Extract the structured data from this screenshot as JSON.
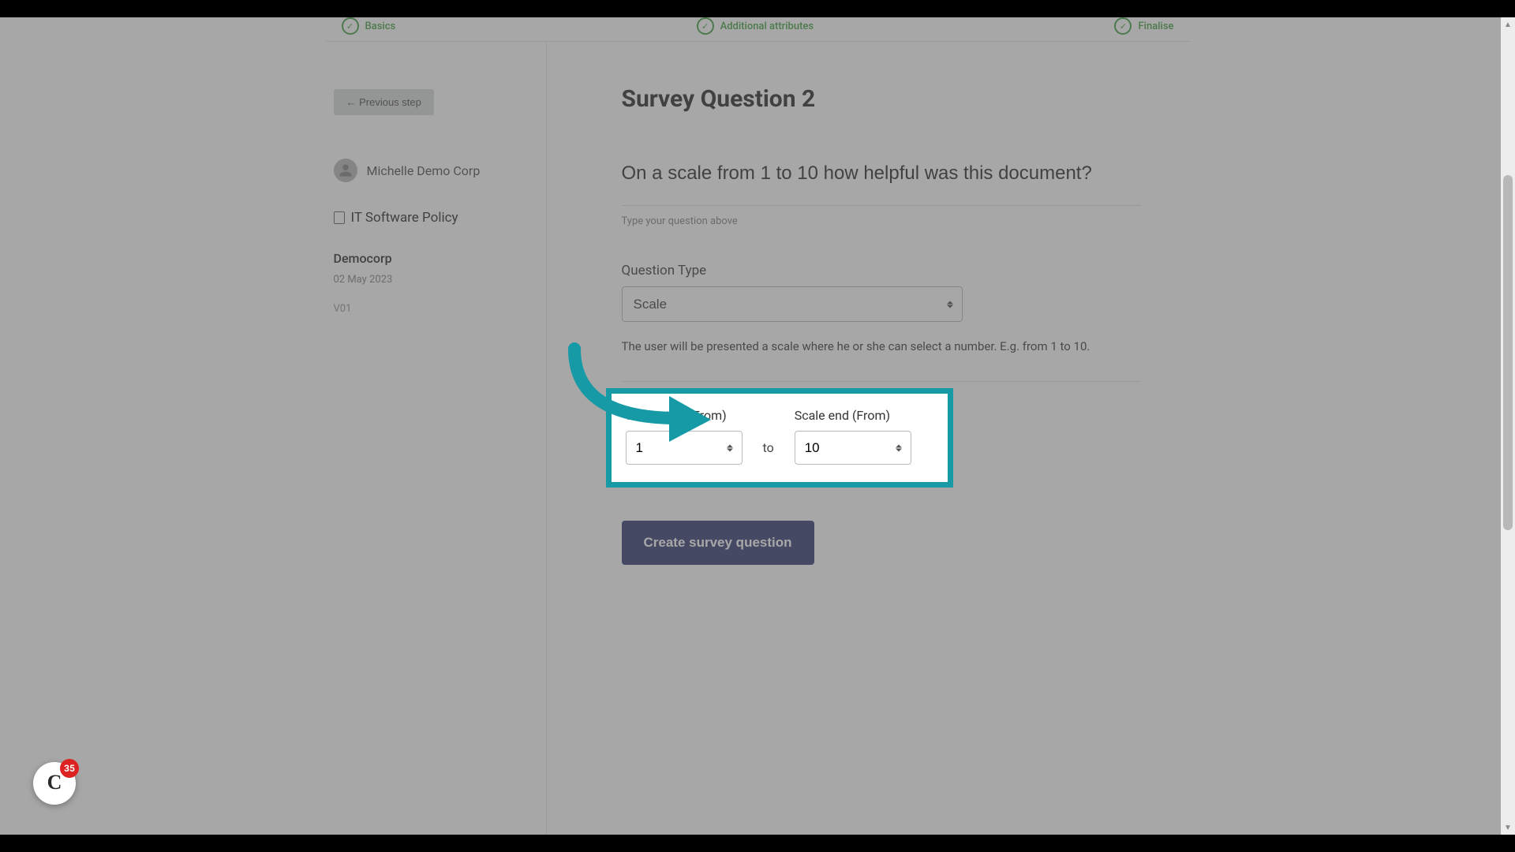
{
  "steps": {
    "one": "Basics",
    "two": "Additional attributes",
    "three": "Finalise"
  },
  "sidebar": {
    "prev_label": "← Previous step",
    "user_name": "Michelle Demo Corp",
    "doc_name": "IT Software Policy",
    "org": "Democorp",
    "date": "02 May 2023",
    "version": "V01"
  },
  "main": {
    "title": "Survey Question 2",
    "question_value": "On a scale from 1 to 10 how helpful was this document?",
    "question_hint": "Type your question above",
    "type_label": "Question Type",
    "type_value": "Scale",
    "type_help": "The user will be presented a scale where he or she can select a number. E.g. from 1 to 10.",
    "scale_start_label": "Scale start (From)",
    "scale_start_value": "1",
    "to_label": "to",
    "scale_end_label": "Scale end (From)",
    "scale_end_value": "10",
    "create_label": "Create survey question"
  },
  "chat": {
    "count": "35"
  },
  "colors": {
    "highlight_border": "#169aa5",
    "primary_btn": "#3d4379",
    "step_green": "#4aa54a"
  }
}
